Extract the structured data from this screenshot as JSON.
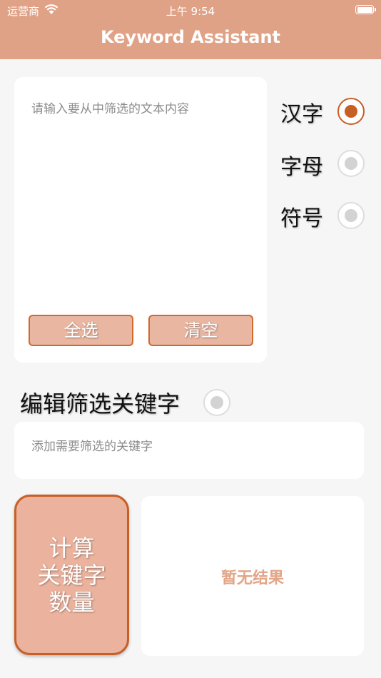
{
  "status_bar": {
    "carrier": "运营商",
    "time": "上午 9:54"
  },
  "nav": {
    "title": "Keyword Assistant"
  },
  "input": {
    "placeholder": "请输入要从中筛选的文本内容",
    "value": ""
  },
  "buttons": {
    "select_all": "全选",
    "clear": "清空",
    "calculate": "计算\n关键字\n数量"
  },
  "options": [
    {
      "label": "汉字",
      "selected": true
    },
    {
      "label": "字母",
      "selected": false
    },
    {
      "label": "符号",
      "selected": false
    }
  ],
  "keyword": {
    "title": "编辑筛选关键字",
    "toggle_selected": false,
    "placeholder": "添加需要筛选的关键字"
  },
  "result": {
    "text": "暂无结果"
  },
  "colors": {
    "header": "#e0a286",
    "accent": "#c75f25",
    "button_fill": "#e9b6a1",
    "result_text": "#e2a587"
  }
}
